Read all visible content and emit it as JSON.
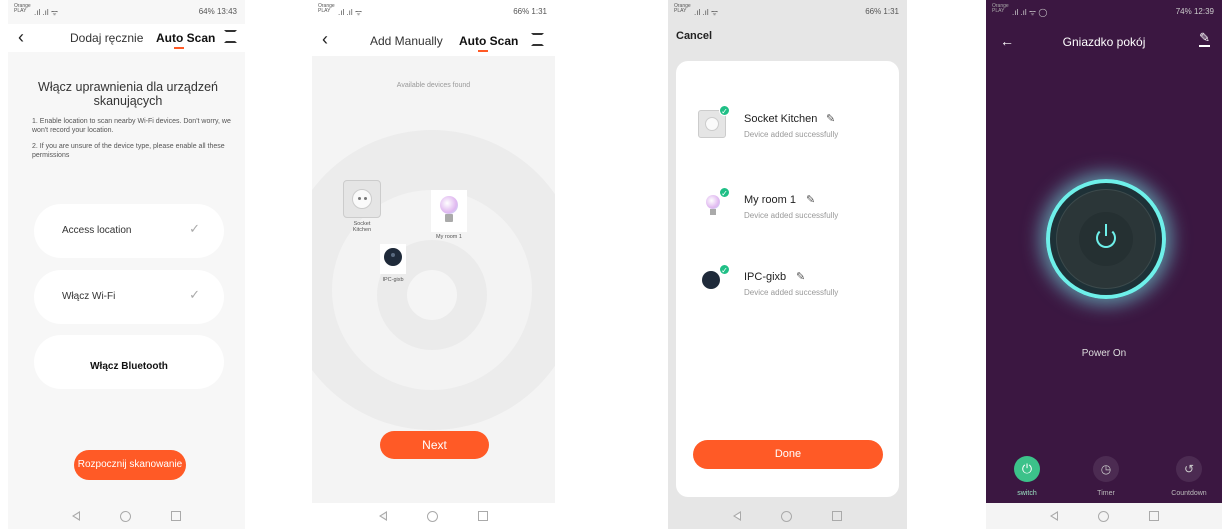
{
  "status": {
    "carrier": "Orange PLAY",
    "p1": "64% 13:43",
    "p2": "66% 1:31",
    "p3": "66% 1:31",
    "p4": "74% 12:39"
  },
  "screen1": {
    "tab_manual": "Dodaj ręcznie",
    "tab_auto": "Auto Scan",
    "title": "Włącz uprawnienia dla urządzeń skanujących",
    "note1": "1. Enable location to scan nearby Wi-Fi devices. Don't worry, we won't record your location.",
    "note2": "2. If you are unsure of the device type, please enable all these permissions",
    "perm_location": "Access location",
    "perm_wifi": "Włącz Wi-Fi",
    "perm_bluetooth": "Włącz Bluetooth",
    "start_button": "Rozpocznij skanowanie"
  },
  "screen2": {
    "tab_manual": "Add Manually",
    "tab_auto": "Auto Scan",
    "found_text": "Available devices found",
    "device_socket": "Socket Kitchen",
    "device_bulb": "My room 1",
    "device_camera": "IPC-gixb",
    "next_button": "Next"
  },
  "screen3": {
    "cancel": "Cancel",
    "devices": [
      {
        "name": "Socket Kitchen",
        "status": "Device added successfully"
      },
      {
        "name": "My room 1",
        "status": "Device added successfully"
      },
      {
        "name": "IPC-gixb",
        "status": "Device added successfully"
      }
    ],
    "done_button": "Done"
  },
  "screen4": {
    "title": "Gniazdko pokój",
    "power_label": "Power On",
    "tab_switch": "switch",
    "tab_timer": "Timer",
    "tab_countdown": "Countdown"
  }
}
